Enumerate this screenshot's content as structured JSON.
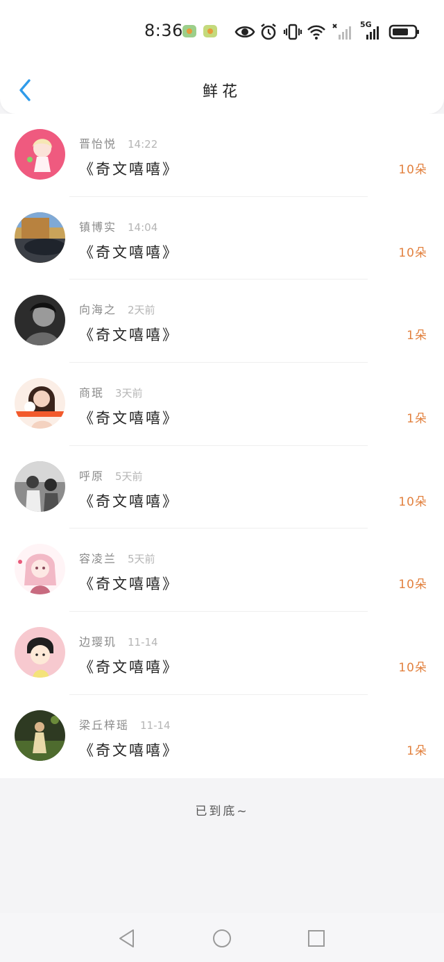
{
  "status_bar": {
    "time": "8:36",
    "icons": [
      "app-icon-1",
      "app-icon-2",
      "eye-icon",
      "alarm-icon",
      "vibrate-icon",
      "wifi-icon",
      "signal-icon",
      "5g-signal-icon",
      "battery-icon"
    ],
    "network_label": "5G"
  },
  "header": {
    "title": "鲜花",
    "back_icon": "chevron-left-icon"
  },
  "colors": {
    "accent_blue": "#2f9bea",
    "count_orange": "#e2813f"
  },
  "records": [
    {
      "name": "晋怡悦",
      "time": "14:22",
      "book": "《奇文嘻嘻》",
      "count": "10朵"
    },
    {
      "name": "镇博实",
      "time": "14:04",
      "book": "《奇文嘻嘻》",
      "count": "10朵"
    },
    {
      "name": "向海之",
      "time": "2天前",
      "book": "《奇文嘻嘻》",
      "count": "1朵"
    },
    {
      "name": "商珉",
      "time": "3天前",
      "book": "《奇文嘻嘻》",
      "count": "1朵"
    },
    {
      "name": "呼原",
      "time": "5天前",
      "book": "《奇文嘻嘻》",
      "count": "10朵"
    },
    {
      "name": "容凌兰",
      "time": "5天前",
      "book": "《奇文嘻嘻》",
      "count": "10朵"
    },
    {
      "name": "边璎玑",
      "time": "11-14",
      "book": "《奇文嘻嘻》",
      "count": "10朵"
    },
    {
      "name": "梁丘梓瑶",
      "time": "11-14",
      "book": "《奇文嘻嘻》",
      "count": "1朵"
    }
  ],
  "footer": {
    "end_text": "已到底~"
  },
  "system_nav": [
    "back-triangle-icon",
    "home-circle-icon",
    "recent-square-icon"
  ]
}
